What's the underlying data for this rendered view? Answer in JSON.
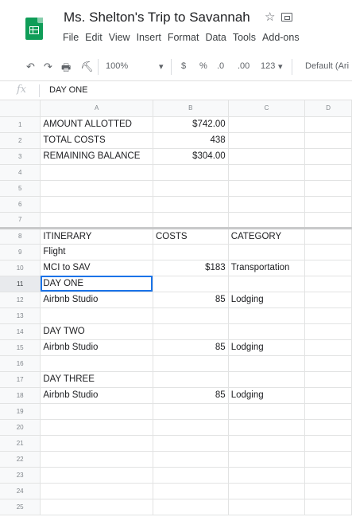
{
  "header": {
    "title": "Ms. Shelton's Trip to Savannah",
    "star_glyph": "☆",
    "menu": [
      "File",
      "Edit",
      "View",
      "Insert",
      "Format",
      "Data",
      "Tools",
      "Add-ons"
    ]
  },
  "toolbar": {
    "zoom": "100%",
    "currency": "$",
    "percent": "%",
    "dec_decrease": ".0",
    "dec_increase": ".00",
    "more_formats": "123",
    "font": "Default (Ari"
  },
  "formula_bar": {
    "fx": "fx",
    "value": "DAY ONE"
  },
  "columns": [
    "A",
    "B",
    "C",
    "D"
  ],
  "rows": [
    {
      "n": "1",
      "a": "AMOUNT ALLOTTED",
      "b": "$742.00",
      "c": ""
    },
    {
      "n": "2",
      "a": "TOTAL COSTS",
      "b": "438",
      "c": ""
    },
    {
      "n": "3",
      "a": "REMAINING BALANCE",
      "b": "$304.00",
      "c": ""
    },
    {
      "n": "4",
      "a": "",
      "b": "",
      "c": ""
    },
    {
      "n": "5",
      "a": "",
      "b": "",
      "c": ""
    },
    {
      "n": "6",
      "a": "",
      "b": "",
      "c": ""
    },
    {
      "n": "7",
      "a": "",
      "b": "",
      "c": ""
    },
    {
      "n": "8",
      "a": "ITINERARY",
      "b": "COSTS",
      "c": "CATEGORY"
    },
    {
      "n": "9",
      "a": "Flight",
      "b": "",
      "c": ""
    },
    {
      "n": "10",
      "a": "MCI to SAV",
      "b": "$183",
      "c": "Transportation"
    },
    {
      "n": "11",
      "a": "DAY ONE",
      "b": "",
      "c": ""
    },
    {
      "n": "12",
      "a": "Airbnb Studio",
      "b": "85",
      "c": "Lodging"
    },
    {
      "n": "13",
      "a": "",
      "b": "",
      "c": ""
    },
    {
      "n": "14",
      "a": "DAY TWO",
      "b": "",
      "c": ""
    },
    {
      "n": "15",
      "a": "Airbnb Studio",
      "b": "85",
      "c": "Lodging"
    },
    {
      "n": "16",
      "a": "",
      "b": "",
      "c": ""
    },
    {
      "n": "17",
      "a": "DAY THREE",
      "b": "",
      "c": ""
    },
    {
      "n": "18",
      "a": "Airbnb Studio",
      "b": "85",
      "c": "Lodging"
    },
    {
      "n": "19",
      "a": "",
      "b": "",
      "c": ""
    },
    {
      "n": "20",
      "a": "",
      "b": "",
      "c": ""
    },
    {
      "n": "21",
      "a": "",
      "b": "",
      "c": ""
    },
    {
      "n": "22",
      "a": "",
      "b": "",
      "c": ""
    },
    {
      "n": "23",
      "a": "",
      "b": "",
      "c": ""
    },
    {
      "n": "24",
      "a": "",
      "b": "",
      "c": ""
    },
    {
      "n": "25",
      "a": "",
      "b": "",
      "c": ""
    }
  ],
  "active_cell": "A11",
  "colors": {
    "accent": "#1a73e8",
    "sheets_green": "#0f9d58"
  }
}
